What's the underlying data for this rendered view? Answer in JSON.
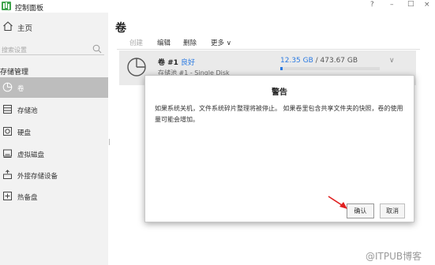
{
  "window": {
    "title": "控制面板",
    "controls": {
      "help": "?",
      "minimize": "–",
      "maximize": "□",
      "close": "×"
    }
  },
  "sidebar": {
    "home_label": "主页",
    "search_placeholder": "搜索设置",
    "section_title": "存储管理",
    "items": [
      {
        "label": "卷",
        "icon": "volume-pie-icon",
        "active": true
      },
      {
        "label": "存储池",
        "icon": "storage-pool-icon",
        "active": false
      },
      {
        "label": "硬盘",
        "icon": "hard-disk-icon",
        "active": false
      },
      {
        "label": "虚拟磁盘",
        "icon": "virtual-disk-icon",
        "active": false
      },
      {
        "label": "外接存储设备",
        "icon": "external-storage-icon",
        "active": false
      },
      {
        "label": "热备盘",
        "icon": "hot-spare-icon",
        "active": false
      }
    ]
  },
  "main": {
    "title": "卷",
    "toolbar": {
      "create": "创建",
      "edit": "编辑",
      "delete": "删除",
      "more": "更多 ∨"
    },
    "volume": {
      "name": "卷 #1",
      "status": "良好",
      "subtitle": "存储池 #1 - Single Disk",
      "used": "12.35 GB",
      "separator": " / ",
      "total": "473.67 GB",
      "usage_fraction": 0.026,
      "chevron": "∨"
    }
  },
  "dialog": {
    "title": "警告",
    "message": "如果系统关机，文件系统碎片整理将被停止。 如果卷里包含共享文件夹的快照，卷的使用量可能会增加。",
    "ok_label": "确认",
    "cancel_label": "取消"
  },
  "watermark": "@ITPUB博客",
  "colors": {
    "accent": "#2a7ae2",
    "sidebar_bg": "#f2f2f2",
    "active_item": "#bdbdbd",
    "arrow": "#e02020",
    "logo": "#3fa34d"
  }
}
